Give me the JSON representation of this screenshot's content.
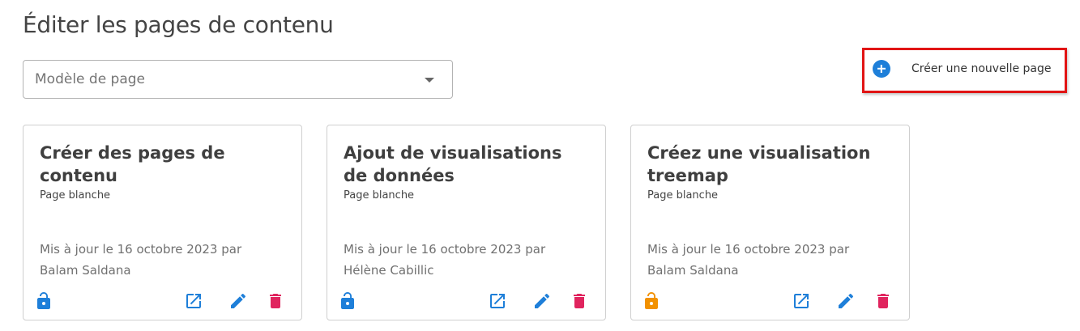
{
  "page": {
    "title": "Éditer les pages de contenu"
  },
  "filter": {
    "placeholder": "Modèle de page"
  },
  "toolbar": {
    "create_label": "Créer une nouvelle page"
  },
  "colors": {
    "accent": "#1e7fd9",
    "danger": "#e0245e",
    "warning": "#f29100",
    "highlight_border": "#e11414"
  },
  "cards": [
    {
      "title": "Créer des pages de contenu",
      "template": "Page blanche",
      "updated": "Mis à jour le 16 octobre 2023 par",
      "author": "Balam Saldana",
      "lock_icon": "unlocked-icon",
      "lock_color": "#1e7fd9"
    },
    {
      "title": "Ajout de visualisations de données",
      "template": "Page blanche",
      "updated": "Mis à jour le 16 octobre 2023 par",
      "author": "Hélène Cabillic",
      "lock_icon": "unlocked-icon",
      "lock_color": "#1e7fd9"
    },
    {
      "title": "Créez une visualisation treemap",
      "template": "Page blanche",
      "updated": "Mis à jour le 16 octobre 2023 par",
      "author": "Balam Saldana",
      "lock_icon": "unlocked-icon",
      "lock_color": "#f29100"
    }
  ]
}
